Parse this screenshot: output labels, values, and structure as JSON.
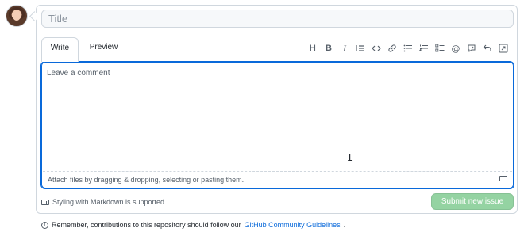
{
  "title_field": {
    "placeholder": "Title",
    "value": ""
  },
  "tabs": [
    {
      "label": "Write",
      "selected": true
    },
    {
      "label": "Preview",
      "selected": false
    }
  ],
  "toolbar": {
    "icons": [
      "heading-icon",
      "bold-icon",
      "italic-icon",
      "quote-icon",
      "code-icon",
      "link-icon",
      "unordered-list-icon",
      "ordered-list-icon",
      "task-list-icon",
      "mention-icon",
      "reference-icon",
      "reply-icon",
      "fullscreen-icon"
    ],
    "heading_label": "H",
    "bold_label": "B",
    "italic_label": "I",
    "mention_label": "@"
  },
  "editor": {
    "placeholder": "Leave a comment",
    "value": "",
    "attach_text": "Attach files by dragging & dropping, selecting or pasting them."
  },
  "footer": {
    "markdown_text": "Styling with Markdown is supported",
    "submit_label": "Submit new issue"
  },
  "notice": {
    "prefix": "Remember, contributions to this repository should follow our",
    "link_text": "GitHub Community Guidelines",
    "suffix": "."
  },
  "colors": {
    "accent": "#0969da",
    "submit_disabled": "#94d3a2",
    "border": "#d0d7de",
    "muted_text": "#57606a"
  }
}
